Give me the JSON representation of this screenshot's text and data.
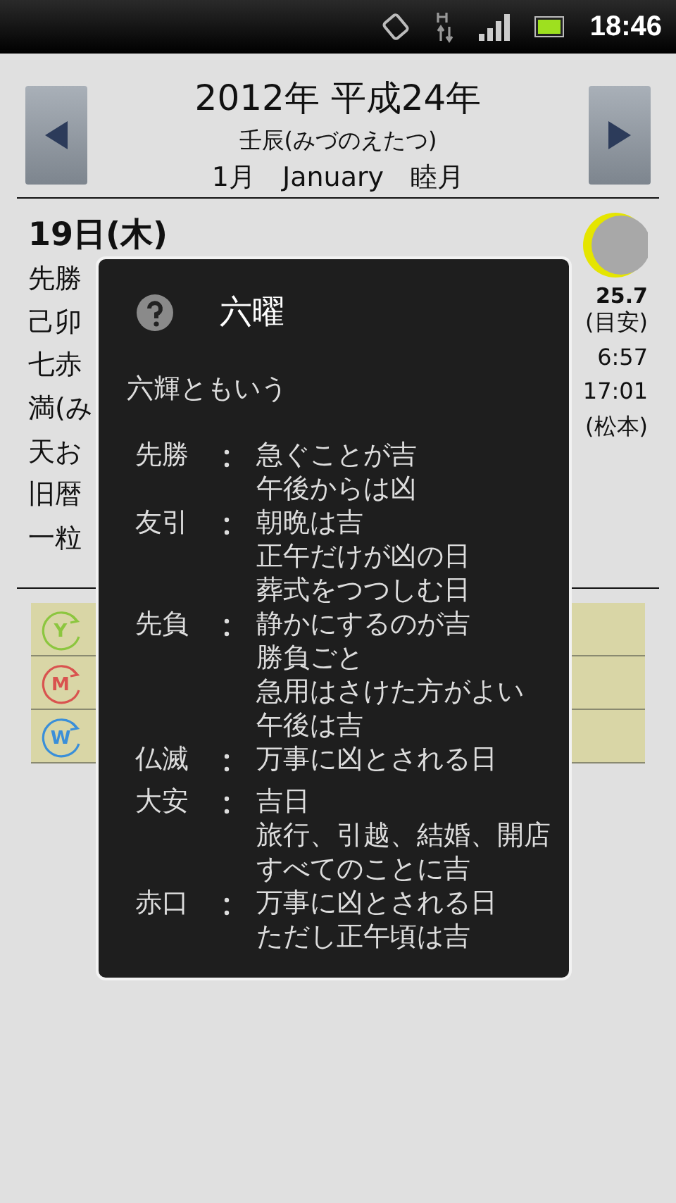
{
  "status_bar": {
    "time": "18:46"
  },
  "header": {
    "year": "2012年 平成24年",
    "eto": "壬辰(みづのえたつ)",
    "month": "1月　January　睦月"
  },
  "day": {
    "date": "19日(木)",
    "left_lines": [
      "先勝",
      "己卯",
      "七赤",
      "満(み",
      "天お",
      "旧暦",
      "一粒"
    ],
    "moon_age": "25.7",
    "right_lines": [
      "(目安)",
      "6:57",
      "17:01",
      "(松本)"
    ]
  },
  "events": [
    {
      "letter": "Y",
      "color": "#8cc63f"
    },
    {
      "letter": "M",
      "color": "#d9534f"
    },
    {
      "letter": "W",
      "color": "#3a8fd9"
    }
  ],
  "dialog": {
    "title": "六曜",
    "subtitle": "六輝ともいう",
    "entries": [
      {
        "label": "先勝",
        "lines": [
          "急ぐことが吉",
          "午後からは凶"
        ]
      },
      {
        "label": "友引",
        "lines": [
          "朝晩は吉",
          "正午だけが凶の日",
          "葬式をつつしむ日"
        ]
      },
      {
        "label": "先負",
        "lines": [
          "静かにするのが吉",
          "勝負ごと",
          "急用はさけた方がよい",
          "午後は吉"
        ]
      },
      {
        "label": "仏滅",
        "lines": [
          "万事に凶とされる日"
        ]
      },
      {
        "label": "大安",
        "lines": [
          "吉日",
          "旅行、引越、結婚、開店",
          "すべてのことに吉"
        ]
      },
      {
        "label": "赤口",
        "lines": [
          "万事に凶とされる日",
          "ただし正午頃は吉"
        ]
      }
    ]
  }
}
